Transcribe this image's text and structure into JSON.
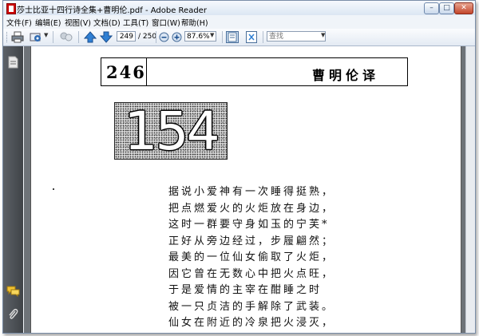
{
  "window": {
    "title": "莎士比亚十四行诗全集+曹明伦.pdf - Adobe Reader",
    "controls": {
      "minimize": "–",
      "maximize": "□",
      "close": "✕"
    }
  },
  "menu": [
    "文件(F)",
    "编辑(E)",
    "视图(V)",
    "文档(D)",
    "工具(T)",
    "窗口(W)",
    "帮助(H)"
  ],
  "toolbar": {
    "page_current": "249",
    "page_total": "/ 250",
    "zoom": "87.6%",
    "search_placeholder": "查找"
  },
  "page": {
    "page_number": "246",
    "translator": "曹明伦译",
    "sonnet_number": "154",
    "poem_lines": [
      "据说小爱神有一次睡得挺熟，",
      "把点燃爱火的火炬放在身边，",
      "这时一群要守身如玉的宁芙*",
      "正好从旁边经过，步履翩然；",
      "最美的一位仙女偷取了火炬，",
      "因它曾在无数心中把火点旺，",
      "于是爱情的主宰在酣睡之时",
      "被一只贞洁的手解除了武装。",
      "仙女在附近的冷泉把火浸灭，"
    ]
  },
  "colors": {
    "accent": "#1f5fa8",
    "panel": "#4e5359",
    "doc_background": "#6e7378"
  }
}
